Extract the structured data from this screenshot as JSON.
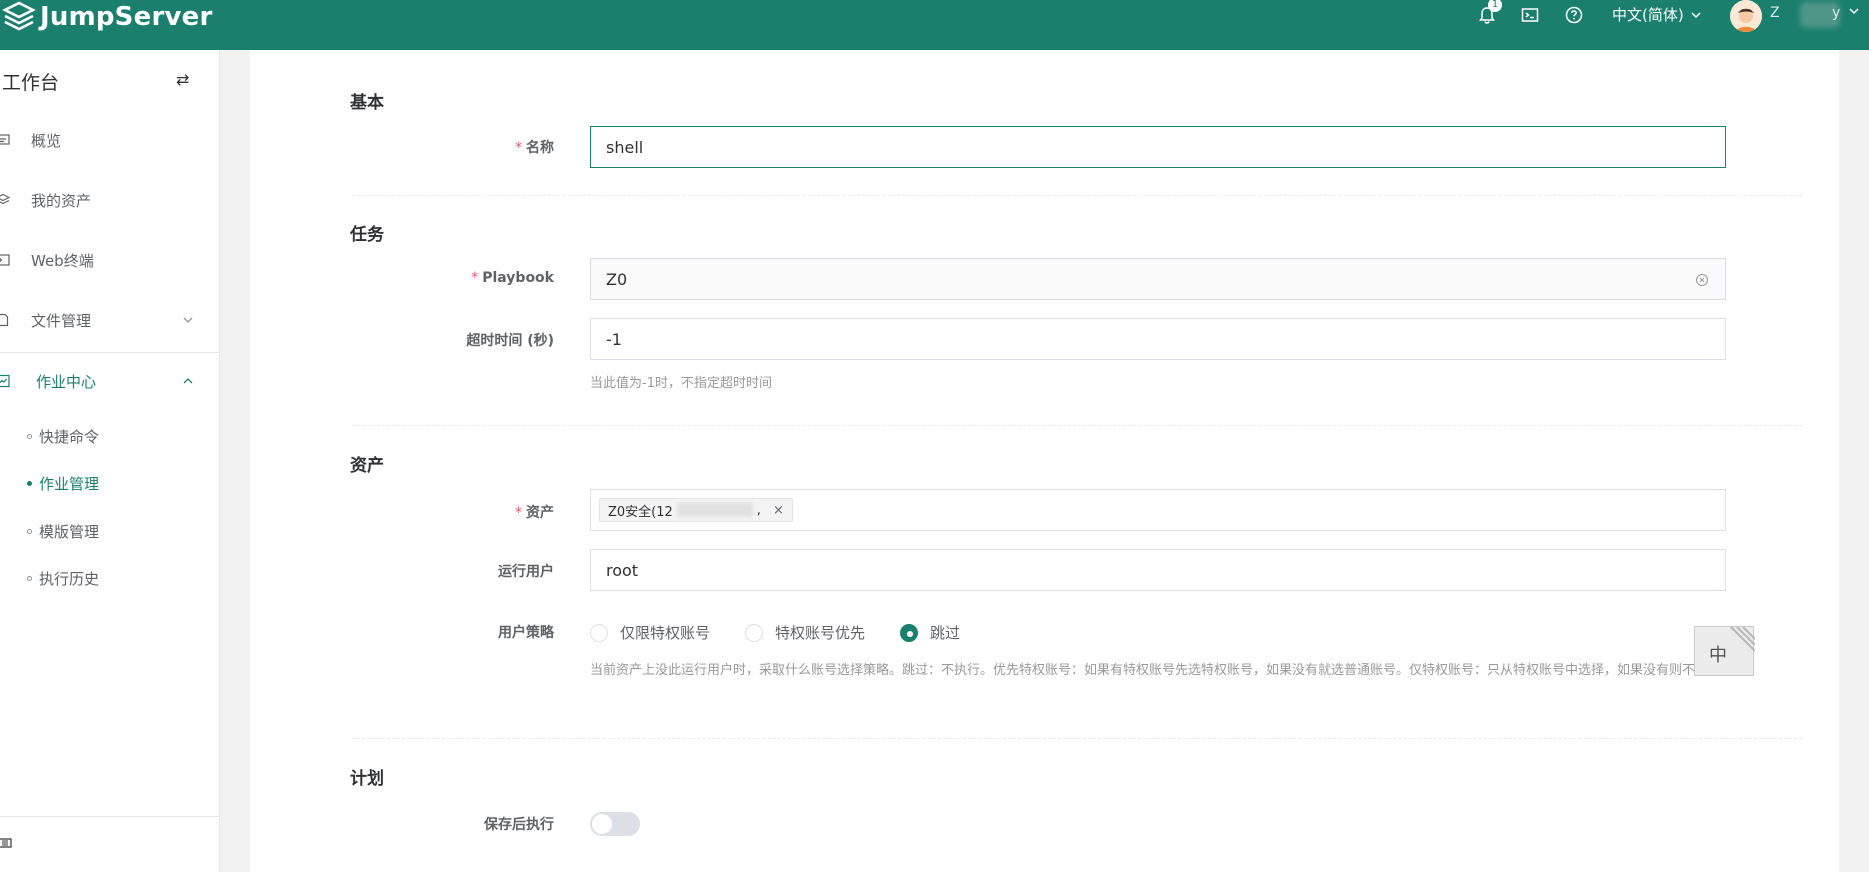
{
  "header": {
    "brand": "JumpServer",
    "notification_count": "1",
    "language": "中文(简体)",
    "user_initial": "Z",
    "user_suffix": "y"
  },
  "sidebar": {
    "title": "工作台",
    "items": [
      {
        "label": "概览",
        "icon": "overview-icon"
      },
      {
        "label": "我的资产",
        "icon": "assets-icon"
      },
      {
        "label": "Web终端",
        "icon": "terminal-icon"
      },
      {
        "label": "文件管理",
        "icon": "file-icon"
      },
      {
        "label": "作业中心",
        "icon": "job-icon"
      }
    ],
    "sub_items": [
      {
        "label": "快捷命令"
      },
      {
        "label": "作业管理"
      },
      {
        "label": "模版管理"
      },
      {
        "label": "执行历史"
      }
    ]
  },
  "form": {
    "sections": {
      "basic": "基本",
      "task": "任务",
      "asset": "资产",
      "plan": "计划"
    },
    "name": {
      "label": "名称",
      "value": "shell"
    },
    "playbook": {
      "label": "Playbook",
      "value": "Z0"
    },
    "timeout": {
      "label": "超时时间 (秒)",
      "value": "-1",
      "help": "当此值为-1时，不指定超时时间"
    },
    "assets": {
      "label": "资产",
      "tag_prefix": "Z0安全(12",
      "tag_suffix": ","
    },
    "run_user": {
      "label": "运行用户",
      "value": "root"
    },
    "user_strategy": {
      "label": "用户策略",
      "options": [
        "仅限特权账号",
        "特权账号优先",
        "跳过"
      ],
      "selected": "跳过",
      "help": "当前资产上没此运行用户时，采取什么账号选择策略。跳过：不执行。优先特权账号：如果有特权账号先选特权账号，如果没有就选普通账号。仅特权账号：只从特权账号中选择，如果没有则不执行"
    },
    "run_after_save": {
      "label": "保存后执行",
      "enabled": false
    }
  },
  "ime": {
    "label": "中"
  },
  "colors": {
    "primary": "#1a7f6c",
    "required": "#ed5565"
  }
}
